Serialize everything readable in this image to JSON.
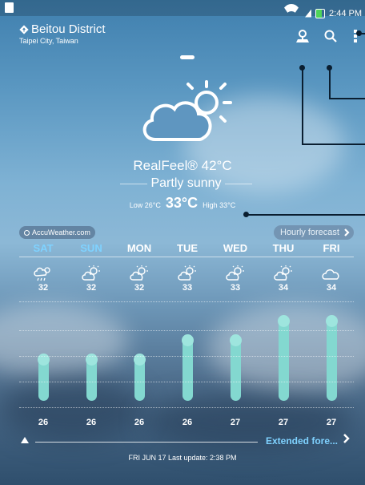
{
  "status_bar": {
    "time": "2:44 PM"
  },
  "location": {
    "name": "Beitou District",
    "sub": "Taipei City, Taiwan"
  },
  "top_icons": [
    "location-pin-icon",
    "search-icon",
    "more-menu-icon"
  ],
  "current": {
    "realfeel": "RealFeel® 42°C",
    "condition": "Partly sunny",
    "low_label": "Low 26°C",
    "now": "33°C",
    "high_label": "High 33°C"
  },
  "provider_label": "AccuWeather.com",
  "hourly_label": "Hourly forecast",
  "days": [
    {
      "name": "SAT",
      "high": "32",
      "low": "26",
      "icon": "rain-sun-icon",
      "weekend": true
    },
    {
      "name": "SUN",
      "high": "32",
      "low": "26",
      "icon": "partly-sunny-icon",
      "weekend": true
    },
    {
      "name": "MON",
      "high": "32",
      "low": "26",
      "icon": "partly-sunny-icon",
      "weekend": false
    },
    {
      "name": "TUE",
      "high": "33",
      "low": "26",
      "icon": "partly-sunny-icon",
      "weekend": false
    },
    {
      "name": "WED",
      "high": "33",
      "low": "27",
      "icon": "partly-sunny-icon",
      "weekend": false
    },
    {
      "name": "THU",
      "high": "34",
      "low": "27",
      "icon": "partly-sunny-icon",
      "weekend": false
    },
    {
      "name": "FRI",
      "high": "34",
      "low": "27",
      "icon": "cloudy-icon",
      "weekend": false
    }
  ],
  "extended_label": "Extended fore...",
  "last_update": "FRI JUN 17 Last update: 2:38 PM",
  "colors": {
    "weekend": "#7fd2ff",
    "bar": "#83d8d0",
    "extended": "#7fd2ff"
  }
}
